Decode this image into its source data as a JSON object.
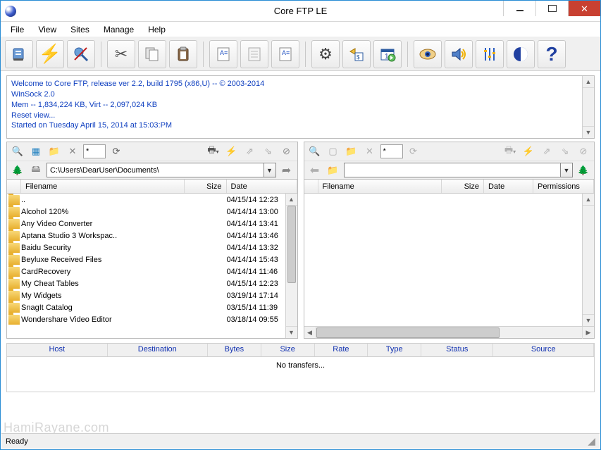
{
  "window": {
    "title": "Core FTP LE",
    "status": "Ready"
  },
  "menu": {
    "items": [
      "File",
      "View",
      "Sites",
      "Manage",
      "Help"
    ]
  },
  "log": {
    "lines": [
      "Welcome to Core FTP, release ver 2.2, build 1795 (x86,U) -- © 2003-2014",
      "WinSock 2.0",
      "Mem -- 1,834,224 KB, Virt -- 2,097,024 KB",
      "Reset view...",
      "Started on Tuesday April 15, 2014 at 15:03:PM"
    ]
  },
  "toolbar": {
    "connect": "Connect",
    "quick": "Quick Connect",
    "disconnect": "Disconnect",
    "cut": "Cut",
    "copy": "Copy",
    "paste": "Paste",
    "editA": "Edit",
    "editB": "Edit Remote",
    "editC": "Compare",
    "gear": "Settings",
    "schedule": "Schedule",
    "sessions": "Sessions",
    "eye": "View",
    "sound": "Sound",
    "options": "Options",
    "logo": "Core FTP",
    "help": "?"
  },
  "paneTools": {
    "filter_value": "*",
    "search": "Search",
    "refresh": "Refresh",
    "newfolder": "New Folder",
    "delete": "Delete",
    "mode": "Mode",
    "upload": "Upload",
    "download": "Download",
    "tree": "Tree",
    "go": "Go",
    "home": "Home",
    "up": "Up"
  },
  "local": {
    "path": "C:\\Users\\DearUser\\Documents\\",
    "columns": {
      "name": "Filename",
      "size": "Size",
      "date": "Date"
    },
    "rows": [
      {
        "name": "..",
        "size": "",
        "date": "04/15/14 12:23"
      },
      {
        "name": "Alcohol 120%",
        "size": "",
        "date": "04/14/14 13:00"
      },
      {
        "name": "Any Video Converter",
        "size": "",
        "date": "04/14/14 13:41"
      },
      {
        "name": "Aptana Studio 3 Workspac..",
        "size": "",
        "date": "04/14/14 13:46"
      },
      {
        "name": "Baidu Security",
        "size": "",
        "date": "04/14/14 13:32"
      },
      {
        "name": "Beyluxe Received Files",
        "size": "",
        "date": "04/14/14 15:43"
      },
      {
        "name": "CardRecovery",
        "size": "",
        "date": "04/14/14 11:46"
      },
      {
        "name": "My Cheat Tables",
        "size": "",
        "date": "04/15/14 12:23"
      },
      {
        "name": "My Widgets",
        "size": "",
        "date": "03/19/14 17:14"
      },
      {
        "name": "SnagIt Catalog",
        "size": "",
        "date": "03/15/14 11:39"
      },
      {
        "name": "Wondershare Video Editor",
        "size": "",
        "date": "03/18/14 09:55"
      }
    ]
  },
  "remote": {
    "path": "",
    "columns": {
      "name": "Filename",
      "size": "Size",
      "date": "Date",
      "perm": "Permissions"
    }
  },
  "queue": {
    "columns": [
      "Host",
      "Destination",
      "Bytes",
      "Size",
      "Rate",
      "Type",
      "Status",
      "Source"
    ],
    "empty": "No transfers..."
  },
  "watermark": "HamiRayane.com"
}
